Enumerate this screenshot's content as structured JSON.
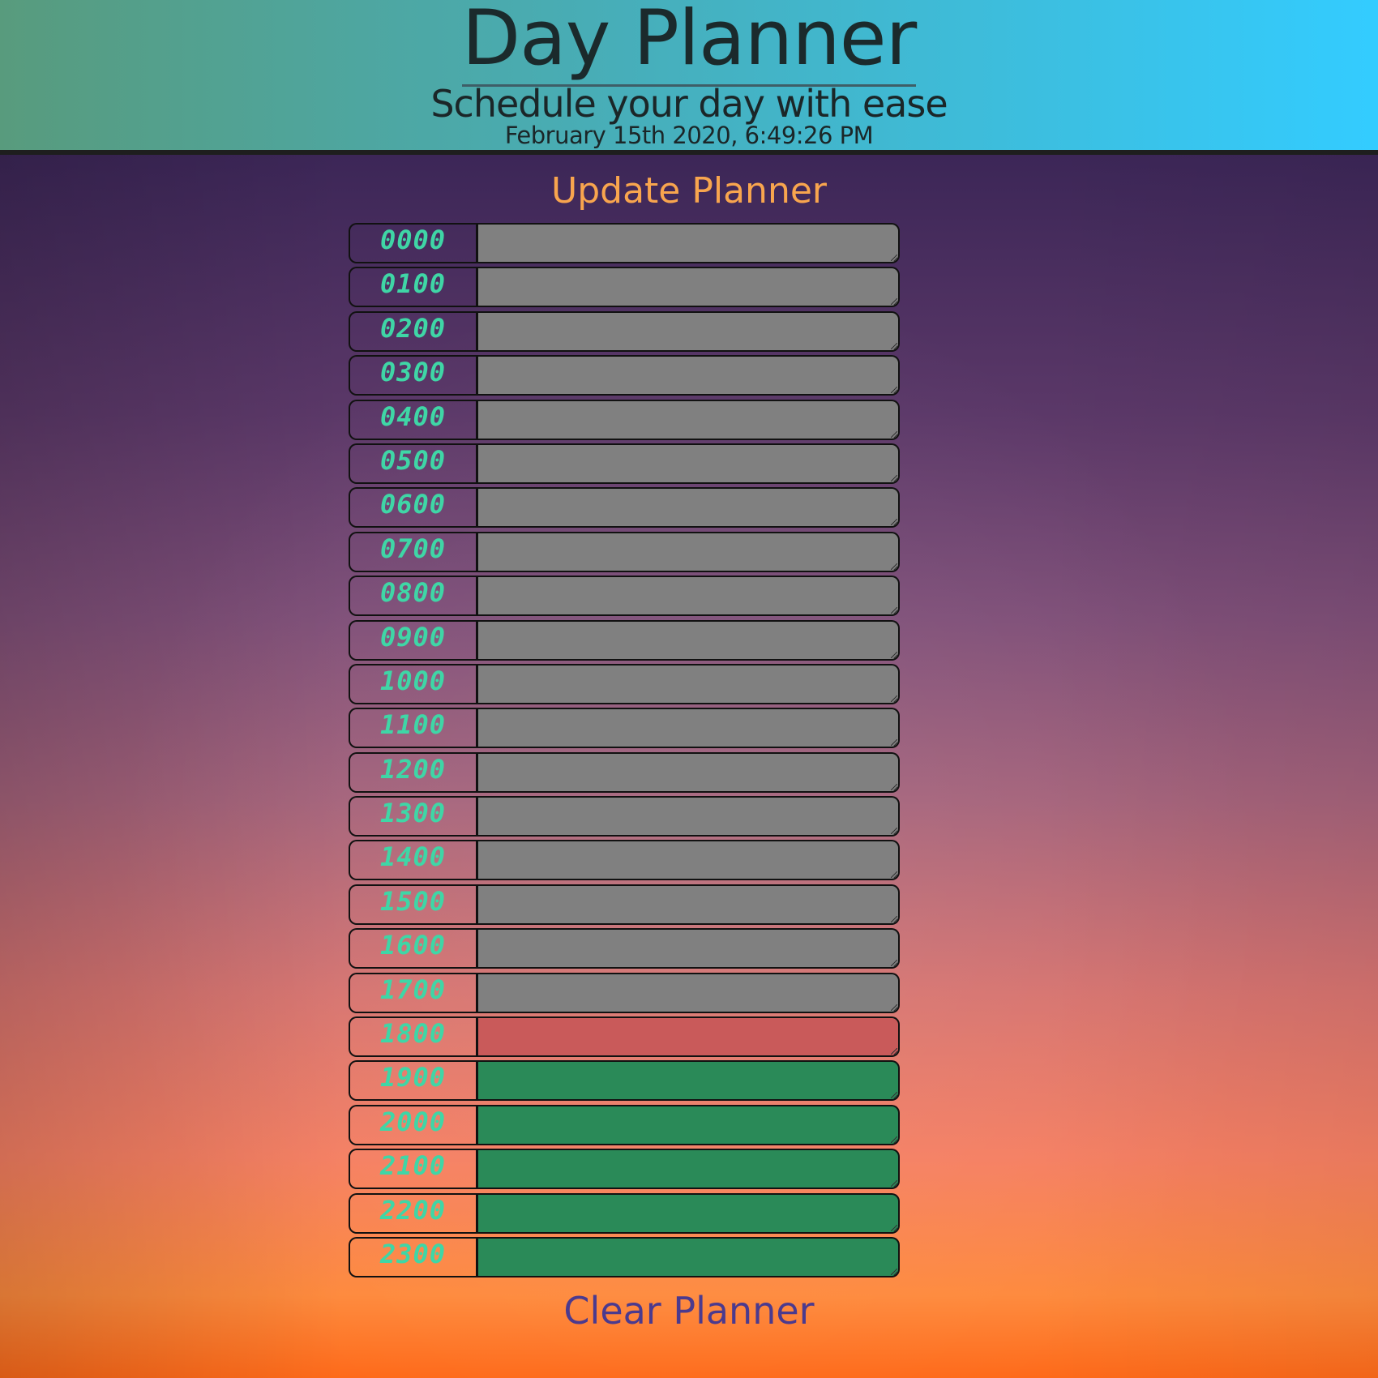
{
  "header": {
    "title": "Day Planner",
    "subtitle": "Schedule your day with ease",
    "datetime": "February 15th 2020, 6:49:26 PM"
  },
  "actions": {
    "update_label": "Update Planner",
    "clear_label": "Clear Planner"
  },
  "colors": {
    "past": "#808080",
    "present": "#c95a5a",
    "future": "#2a8a58",
    "hour_label": "#3fd6a6",
    "update_button": "#f8a54e",
    "clear_button": "#4b3a8e"
  },
  "planner": {
    "rows": [
      {
        "hour": "0000",
        "status": "past",
        "value": ""
      },
      {
        "hour": "0100",
        "status": "past",
        "value": ""
      },
      {
        "hour": "0200",
        "status": "past",
        "value": ""
      },
      {
        "hour": "0300",
        "status": "past",
        "value": ""
      },
      {
        "hour": "0400",
        "status": "past",
        "value": ""
      },
      {
        "hour": "0500",
        "status": "past",
        "value": ""
      },
      {
        "hour": "0600",
        "status": "past",
        "value": ""
      },
      {
        "hour": "0700",
        "status": "past",
        "value": ""
      },
      {
        "hour": "0800",
        "status": "past",
        "value": ""
      },
      {
        "hour": "0900",
        "status": "past",
        "value": ""
      },
      {
        "hour": "1000",
        "status": "past",
        "value": ""
      },
      {
        "hour": "1100",
        "status": "past",
        "value": ""
      },
      {
        "hour": "1200",
        "status": "past",
        "value": ""
      },
      {
        "hour": "1300",
        "status": "past",
        "value": ""
      },
      {
        "hour": "1400",
        "status": "past",
        "value": ""
      },
      {
        "hour": "1500",
        "status": "past",
        "value": ""
      },
      {
        "hour": "1600",
        "status": "past",
        "value": ""
      },
      {
        "hour": "1700",
        "status": "past",
        "value": ""
      },
      {
        "hour": "1800",
        "status": "present",
        "value": ""
      },
      {
        "hour": "1900",
        "status": "future",
        "value": ""
      },
      {
        "hour": "2000",
        "status": "future",
        "value": ""
      },
      {
        "hour": "2100",
        "status": "future",
        "value": ""
      },
      {
        "hour": "2200",
        "status": "future",
        "value": ""
      },
      {
        "hour": "2300",
        "status": "future",
        "value": ""
      }
    ]
  }
}
